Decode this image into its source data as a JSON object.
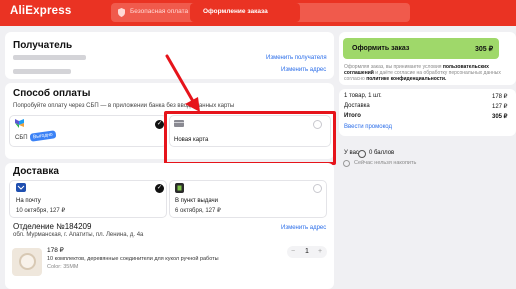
{
  "header": {
    "logo": "AliExpress",
    "secure_label": "Безопасная оплата",
    "tab_checkout": "Оформление заказа"
  },
  "recipient": {
    "title": "Получатель",
    "change_recipient": "Изменить получателя",
    "change_address": "Изменить адрес"
  },
  "payment": {
    "title": "Способ оплаты",
    "hint": "Попробуйте оплату через СБП — в приложении банка без ввода данных карты",
    "sbp_label": "СБП",
    "sbp_badge": "Выгодно",
    "new_card_label": "Новая карта"
  },
  "delivery": {
    "title": "Доставка",
    "options": [
      {
        "label": "На почту",
        "date": "10 октября, 127 ₽"
      },
      {
        "label": "В пункт выдачи",
        "date": "6 октября, 127 ₽"
      }
    ],
    "office_title": "Отделение №184209",
    "office_address": "обл. Мурманская, г. Апатиты, пл. Ленина, д. 4а",
    "change_address": "Изменить адрес"
  },
  "item": {
    "price": "178 ₽",
    "name": "10 комплектов, деревянные соединители для кукол ручной работы",
    "color": "Color: 35MM",
    "qty": "1",
    "minus": "−",
    "plus": "+"
  },
  "summary": {
    "order_button": "Оформить заказ",
    "order_total": "305 ₽",
    "legal_text_1": "Оформляя заказ, вы принимаете условия",
    "legal_link_1": "пользовательских соглашений",
    "legal_text_2": "и даёте согласие на обработку персональных данных согласно",
    "legal_link_2": "политике конфиденциальности.",
    "items_label": "1 товар, 1 шт.",
    "items_value": "178 ₽",
    "delivery_label": "Доставка",
    "delivery_value": "127 ₽",
    "total_label": "Итого",
    "total_value": "305 ₽",
    "promo_link": "Ввести промокод",
    "you_have": "У вас",
    "points": "0 баллов",
    "cannot_accrue": "Сейчас нельзя накопить"
  },
  "colors": {
    "brand_red": "#ea3323",
    "order_button_green": "#9fd86a",
    "link_blue": "#2a6de9",
    "highlight_red": "#e6141b"
  }
}
